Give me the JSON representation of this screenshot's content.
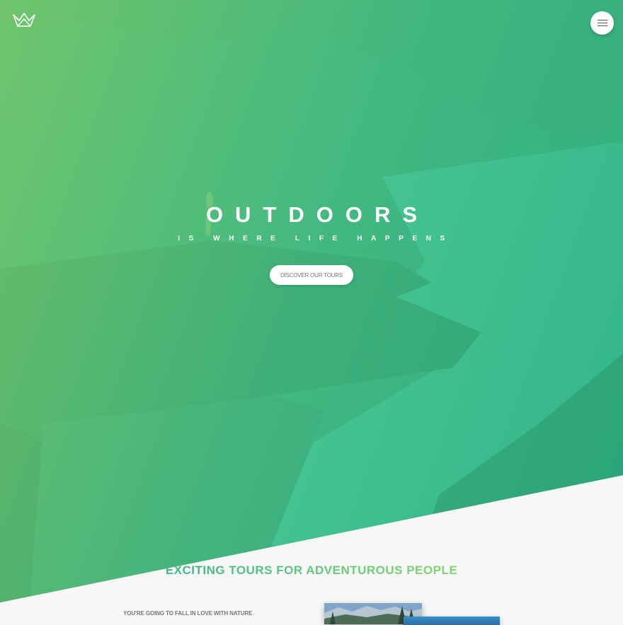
{
  "header": {
    "logo_icon": "crown-logo-icon",
    "menu_icon": "hamburger-menu-icon"
  },
  "hero": {
    "title": "OUTDOORS",
    "subtitle": "IS WHERE LIFE HAPPENS",
    "cta_label": "DISCOVER OUR TOURS",
    "gradient_colors": [
      "#7ed56f",
      "#28b485"
    ]
  },
  "about": {
    "heading": "EXCITING TOURS FOR ADVENTUROUS PEOPLE",
    "intro_heading": "YOU'RE GOING TO FALL IN LOVE WITH NATURE"
  },
  "colors": {
    "accent_light": "#7ed56f",
    "accent_dark": "#28b485",
    "section_bg": "#f7f7f7"
  }
}
